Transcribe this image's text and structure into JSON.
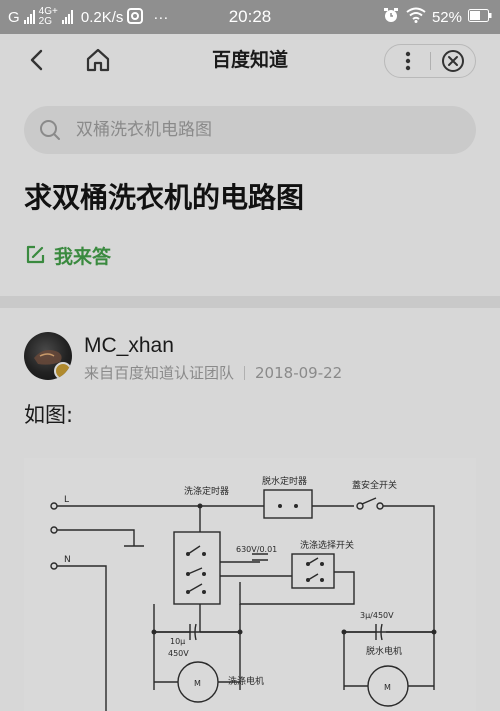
{
  "status_bar": {
    "carrier": "G",
    "network_top": "4G+",
    "network_bottom": "2G",
    "speed": "0.2K/s",
    "more": "···",
    "time": "20:28",
    "battery": "52%"
  },
  "nav": {
    "title": "百度知道"
  },
  "search": {
    "placeholder": "双桶洗衣机电路图"
  },
  "question": {
    "title": "求双桶洗衣机的电路图",
    "answer_label": "我来答"
  },
  "answer": {
    "author_name": "MC_xhan",
    "author_source": "来自百度知道认证团队",
    "date": "2018-09-22",
    "text": "如图:"
  },
  "diagram": {
    "label_l": "L",
    "label_n": "N",
    "wash_timer": "洗涤定时器",
    "spin_timer": "脱水定时器",
    "safety_switch": "蓋安全开关",
    "cap_small": "630V/0.01",
    "wash_select": "洗涤选择开关",
    "cap_wash": "10μ",
    "cap_wash_v": "450V",
    "cap_spin": "3μ/450V",
    "motor_wash": "洗涤电机",
    "motor_spin": "脱水电机",
    "motor_letter": "M"
  }
}
